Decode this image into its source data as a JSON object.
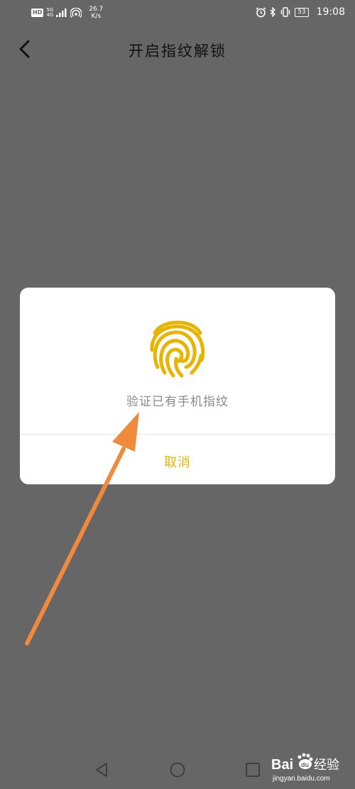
{
  "status_bar": {
    "hd": "HD",
    "network_top": "5G",
    "network_bottom": "4G",
    "speed_value": "26.7",
    "speed_unit": "K/s",
    "battery": "53",
    "time": "19:08"
  },
  "header": {
    "title": "开启指纹解锁",
    "back_icon": "chevron-left-icon"
  },
  "dialog": {
    "icon": "fingerprint-icon",
    "message": "验证已有手机指纹",
    "cancel_label": "取消"
  },
  "nav_bar": {
    "back_icon": "triangle-back-icon",
    "home_icon": "circle-home-icon",
    "recent_icon": "square-recent-icon"
  },
  "watermark": {
    "brand": "Baidu经验",
    "url": "jingyan.baidu.com"
  },
  "colors": {
    "overlay": "#666666",
    "accent": "#e8b400",
    "arrow": "#f08a3c"
  }
}
